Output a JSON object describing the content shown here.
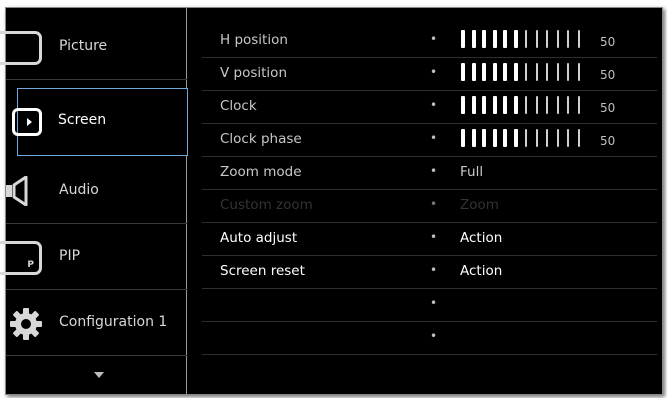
{
  "sidebar": {
    "items": [
      {
        "label": "Picture",
        "icon": "picture-icon"
      },
      {
        "label": "Screen",
        "icon": "screen-icon",
        "selected": true
      },
      {
        "label": "Audio",
        "icon": "speaker-icon"
      },
      {
        "label": "PIP",
        "icon": "pip-icon",
        "badge": "P"
      },
      {
        "label": "Configuration 1",
        "icon": "gear-icon"
      }
    ],
    "scroll_icon": "chevron-down-icon"
  },
  "main": {
    "rows": [
      {
        "label": "H position",
        "type": "slider",
        "value": 50,
        "level": 0.5
      },
      {
        "label": "V position",
        "type": "slider",
        "value": 50,
        "level": 0.5
      },
      {
        "label": "Clock",
        "type": "slider",
        "value": 50,
        "level": 0.5
      },
      {
        "label": "Clock phase",
        "type": "slider",
        "value": 50,
        "level": 0.5
      },
      {
        "label": "Zoom mode",
        "type": "text",
        "value": "Full"
      },
      {
        "label": "Custom zoom",
        "type": "text",
        "value": "Zoom",
        "disabled": true
      },
      {
        "label": "Auto adjust",
        "type": "text",
        "value": "Action",
        "active": true
      },
      {
        "label": "Screen reset",
        "type": "text",
        "value": "Action",
        "active": true
      },
      {
        "label": "",
        "type": "empty",
        "value": ""
      },
      {
        "label": "",
        "type": "empty",
        "value": ""
      }
    ],
    "bullet": "•"
  },
  "colors": {
    "background": "#000000",
    "selection_border": "#6fa9dd",
    "text": "#c8c8c8",
    "text_active": "#ffffff"
  }
}
